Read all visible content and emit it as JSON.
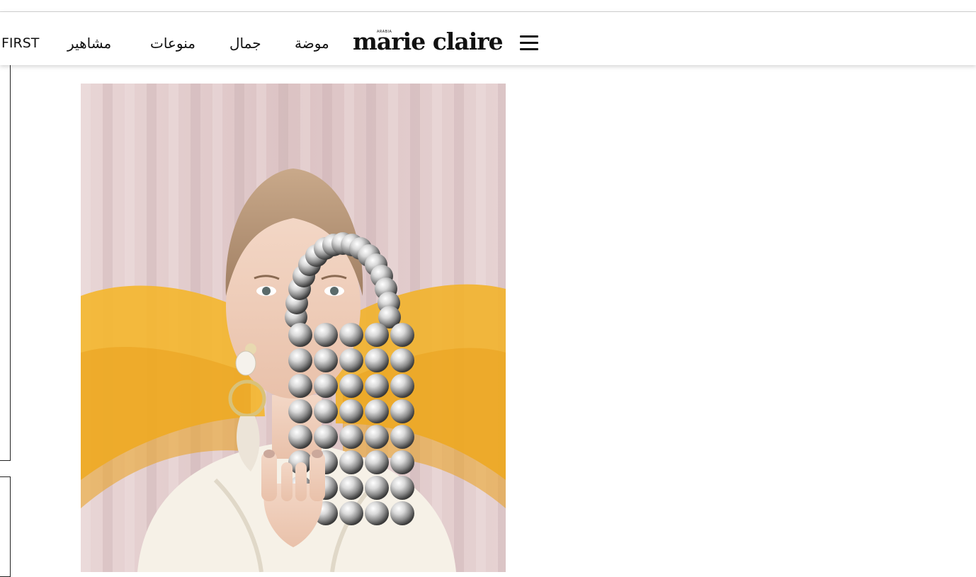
{
  "nav": {
    "items": [
      {
        "label": "FIRST"
      },
      {
        "label": "مشاهير"
      },
      {
        "label": "منوعات"
      },
      {
        "label": "جمال"
      },
      {
        "label": "موضة"
      }
    ]
  },
  "logo": {
    "text": "marie claire",
    "mini": "ARABIA"
  },
  "menu": {
    "icon": "hamburger-menu-icon"
  },
  "article": {
    "image_subject": "woman holding beaded silver ball bag in front of face"
  },
  "colors": {
    "accent_yellow": "#f3b52a",
    "curtain_pink": "#e3cfcf",
    "text": "#111111"
  }
}
